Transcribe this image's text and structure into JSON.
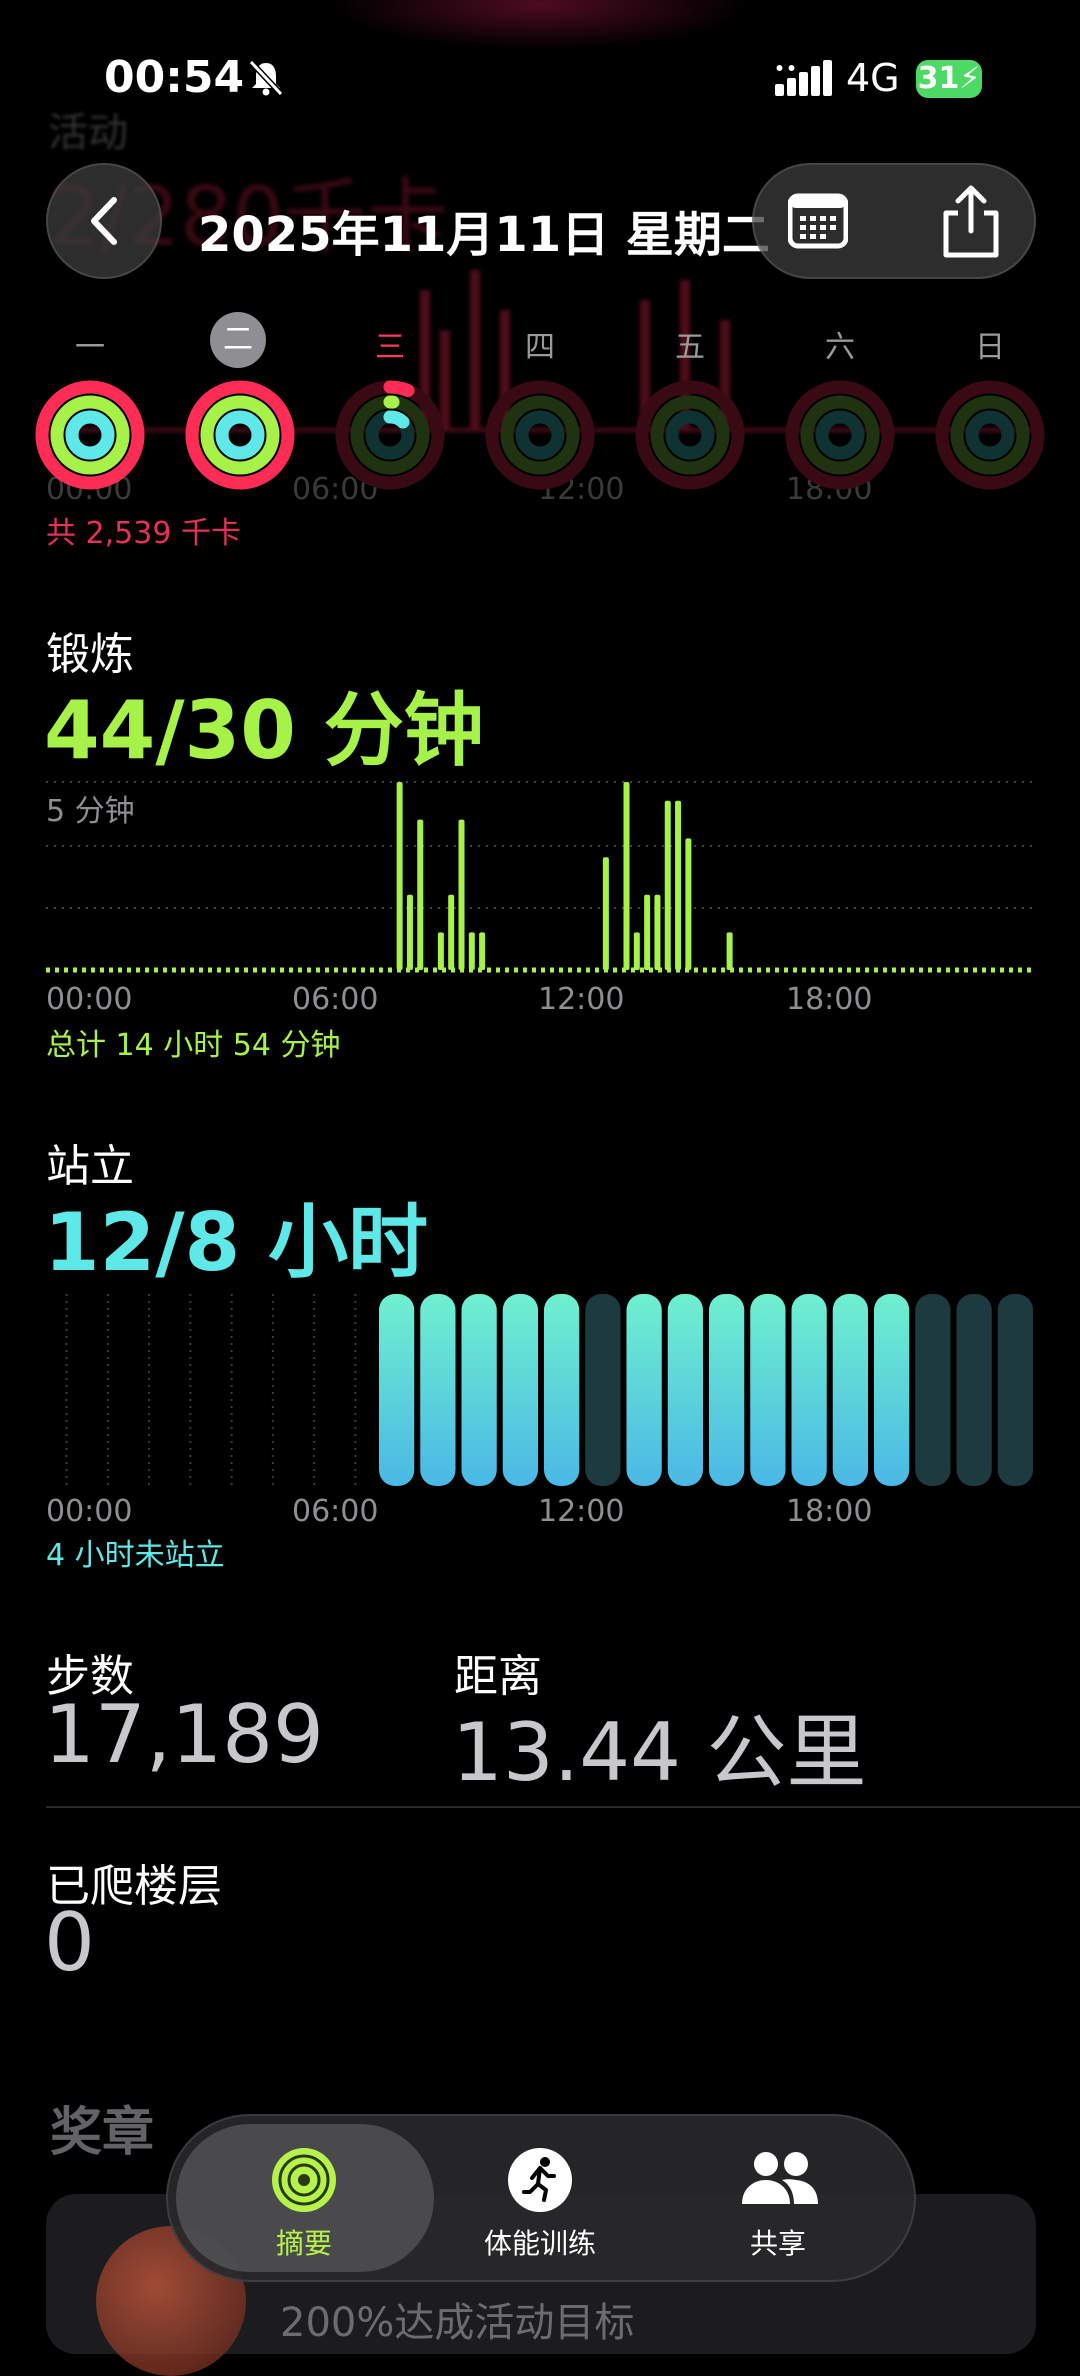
{
  "status_bar": {
    "time": "00:54",
    "network": "4G",
    "battery": "31"
  },
  "header": {
    "date": "2025年11月11日 星期二"
  },
  "background_ghost": {
    "title": "活动",
    "value": "2/280千卡",
    "ticks": [
      "00:00",
      "06:00",
      "12:00",
      "18:00"
    ],
    "total": "共 2,539 千卡"
  },
  "week": {
    "days": [
      "一",
      "二",
      "三",
      "四",
      "五",
      "六",
      "日"
    ],
    "selected_index": 1,
    "today_index": 2
  },
  "exercise": {
    "label": "锻炼",
    "value": "44/30 分钟",
    "y_max_label": "5 分钟",
    "ticks": [
      "00:00",
      "06:00",
      "12:00",
      "18:00"
    ],
    "summary": "总计 14 小时 54 分钟",
    "color": "#a7f249"
  },
  "stand": {
    "label": "站立",
    "value": "12/8 小时",
    "ticks": [
      "00:00",
      "06:00",
      "12:00",
      "18:00"
    ],
    "summary": "4 小时未站立",
    "color": "#5ee8e8"
  },
  "stats": {
    "steps_label": "步数",
    "steps_value": "17,189",
    "distance_label": "距离",
    "distance_value": "13.44 公里",
    "floors_label": "已爬楼层",
    "floors_value": "0"
  },
  "medals": {
    "title": "奖章",
    "item_text": "200%达成活动目标"
  },
  "tabbar": {
    "tabs": [
      {
        "label": "摘要",
        "icon": "rings-icon"
      },
      {
        "label": "体能训练",
        "icon": "running-icon"
      },
      {
        "label": "共享",
        "icon": "people-icon"
      }
    ]
  },
  "chart_data": [
    {
      "type": "bar",
      "title": "锻炼",
      "x": [
        "08:30",
        "08:45",
        "09:00",
        "09:30",
        "09:45",
        "10:00",
        "10:15",
        "10:30",
        "13:30",
        "14:00",
        "14:15",
        "14:30",
        "14:45",
        "15:00",
        "15:15",
        "15:30",
        "16:30"
      ],
      "values": [
        5,
        2,
        4,
        1,
        2,
        4,
        1,
        1,
        3,
        5,
        1,
        2,
        2,
        4.5,
        4.5,
        3.5,
        1
      ],
      "y_unit": "分钟",
      "ylim": [
        0,
        5
      ]
    },
    {
      "type": "bar",
      "title": "站立",
      "categories": [
        "0",
        "1",
        "2",
        "3",
        "4",
        "5",
        "6",
        "7",
        "8",
        "9",
        "10",
        "11",
        "12",
        "13",
        "14",
        "15",
        "16",
        "17",
        "18",
        "19",
        "20",
        "21",
        "22",
        "23"
      ],
      "values": [
        0,
        0,
        0,
        0,
        0,
        0,
        0,
        0,
        1,
        1,
        1,
        1,
        1,
        0,
        1,
        1,
        1,
        1,
        1,
        1,
        1,
        0,
        0,
        0
      ],
      "note_encoding": "1 = stood during hour, 0 = did not"
    }
  ]
}
